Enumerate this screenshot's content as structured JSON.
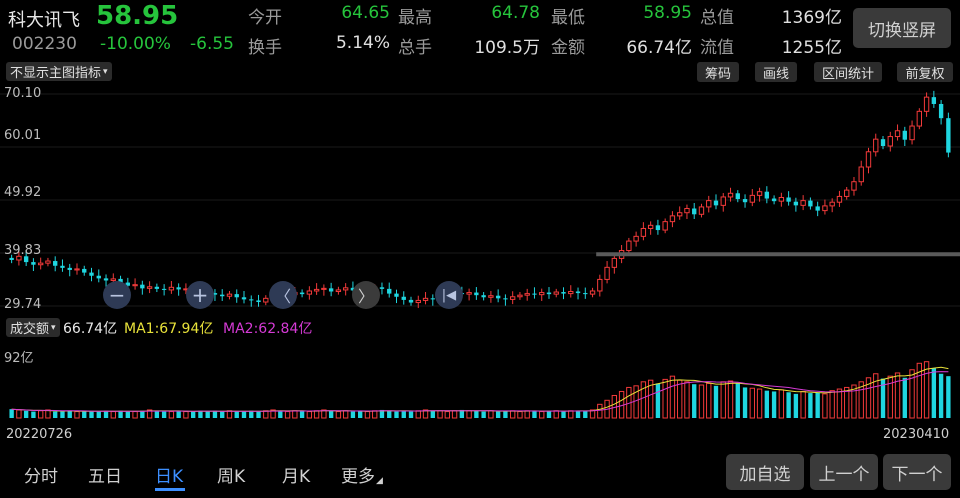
{
  "header": {
    "name": "科大讯飞",
    "price": "58.95",
    "code": "002230",
    "change_pct": "-10.00%",
    "change_val": "-6.55",
    "switch_label": "切换竖屏",
    "quote": [
      {
        "label": "今开",
        "value": "64.65",
        "color": "green"
      },
      {
        "label": "最高",
        "value": "64.78",
        "color": "green"
      },
      {
        "label": "最低",
        "value": "58.95",
        "color": "green"
      },
      {
        "label": "总值",
        "value": "1369亿",
        "color": "white"
      },
      {
        "label": "换手",
        "value": "5.14%",
        "color": "white"
      },
      {
        "label": "总手",
        "value": "109.5万",
        "color": "white"
      },
      {
        "label": "金额",
        "value": "66.74亿",
        "color": "white"
      },
      {
        "label": "流值",
        "value": "1255亿",
        "color": "white"
      }
    ]
  },
  "toolbar": {
    "indicator_select": "不显示主图指标",
    "buttons": [
      "筹码",
      "画线",
      "区间统计",
      "前复权"
    ]
  },
  "price_axis": [
    "70.10",
    "60.01",
    "49.92",
    "39.83",
    "29.74"
  ],
  "volume_bar": {
    "selector": "成交额",
    "value": "66.74亿",
    "ma1": "MA1:67.94亿",
    "ma2": "MA2:62.84亿",
    "max_label": "92亿"
  },
  "dates": {
    "start": "20220726",
    "end": "20230410"
  },
  "tabs": [
    "分时",
    "五日",
    "日K",
    "周K",
    "月K",
    "更多"
  ],
  "active_tab": "日K",
  "bottom_buttons": [
    "加自选",
    "上一个",
    "下一个"
  ],
  "colors": {
    "up": "#f23a3a",
    "down": "#1fd6e0",
    "green": "#26c43c",
    "active": "#3d8fff",
    "ma1": "#e8e23a",
    "ma2": "#d53ad5"
  },
  "chart_data": {
    "type": "candlestick",
    "ylim": [
      29.74,
      70.1
    ],
    "volume_max": 92,
    "close": [
      38.5,
      39.2,
      38.1,
      37.6,
      37.9,
      38.3,
      37.4,
      37.0,
      36.6,
      36.8,
      36.1,
      35.5,
      35.0,
      34.6,
      34.9,
      34.2,
      33.6,
      33.8,
      33.1,
      33.4,
      33.0,
      32.8,
      33.3,
      32.9,
      33.0,
      32.6,
      32.4,
      32.2,
      31.9,
      31.6,
      32.0,
      31.4,
      31.0,
      30.8,
      30.5,
      31.2,
      31.8,
      31.4,
      31.9,
      32.3,
      32.0,
      32.6,
      32.9,
      33.1,
      32.5,
      32.8,
      33.2,
      32.7,
      32.4,
      32.9,
      33.3,
      33.0,
      32.1,
      31.5,
      30.9,
      30.4,
      30.8,
      31.2,
      31.0,
      31.5,
      31.9,
      32.2,
      32.0,
      32.3,
      31.8,
      31.4,
      31.7,
      31.2,
      31.0,
      31.5,
      31.8,
      32.1,
      31.9,
      32.3,
      32.0,
      32.4,
      32.1,
      32.5,
      32.2,
      32.0,
      32.6,
      34.8,
      37.1,
      38.8,
      40.3,
      42.1,
      43.0,
      44.5,
      45.1,
      44.2,
      45.8,
      46.9,
      47.5,
      48.3,
      47.2,
      48.6,
      49.8,
      48.9,
      50.5,
      51.2,
      50.1,
      49.5,
      50.8,
      51.5,
      50.2,
      49.7,
      50.4,
      49.6,
      48.9,
      49.8,
      48.7,
      47.9,
      48.8,
      49.5,
      50.6,
      51.8,
      53.4,
      56.2,
      59.1,
      61.5,
      60.2,
      62.0,
      63.1,
      61.4,
      64.0,
      66.8,
      69.5,
      68.2,
      65.5,
      58.95
    ],
    "volume": [
      11,
      10,
      9,
      8,
      9,
      10,
      8,
      8,
      9,
      8,
      9,
      8,
      8,
      9,
      8,
      9,
      8,
      8,
      9,
      10,
      9,
      8,
      8,
      9,
      8,
      8,
      9,
      8,
      9,
      8,
      9,
      8,
      8,
      9,
      8,
      9,
      10,
      9,
      8,
      9,
      9,
      8,
      9,
      10,
      9,
      8,
      9,
      8,
      9,
      8,
      9,
      10,
      9,
      8,
      9,
      8,
      9,
      10,
      9,
      9,
      8,
      9,
      10,
      9,
      9,
      8,
      9,
      8,
      9,
      9,
      8,
      9,
      9,
      8,
      9,
      9,
      8,
      9,
      9,
      9,
      10,
      17,
      22,
      28,
      33,
      38,
      40,
      45,
      47,
      43,
      48,
      52,
      47,
      45,
      42,
      41,
      43,
      40,
      45,
      46,
      43,
      38,
      37,
      36,
      34,
      33,
      35,
      32,
      30,
      33,
      31,
      32,
      30,
      34,
      36,
      38,
      41,
      45,
      50,
      55,
      49,
      52,
      56,
      50,
      60,
      68,
      70,
      62,
      55,
      52
    ],
    "ma1": [],
    "ma2": []
  }
}
